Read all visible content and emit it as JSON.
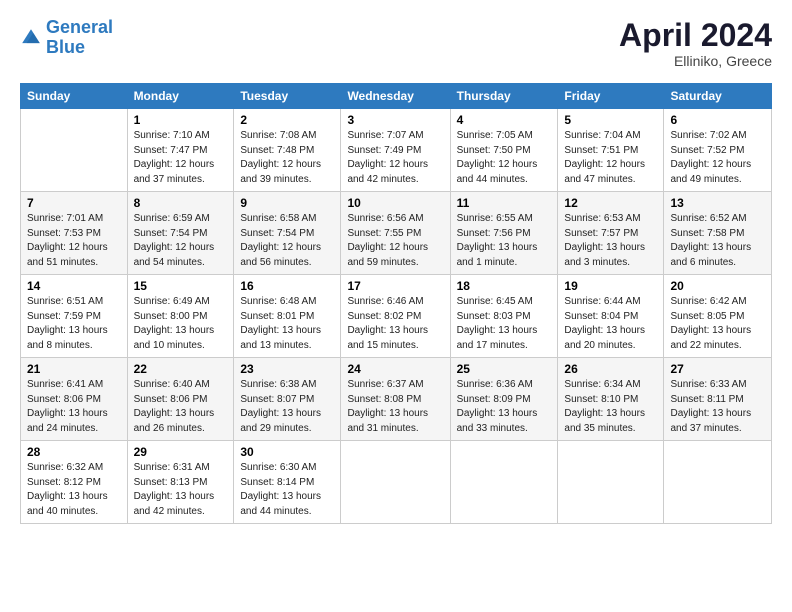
{
  "header": {
    "logo_line1": "General",
    "logo_line2": "Blue",
    "month_title": "April 2024",
    "location": "Elliniko, Greece"
  },
  "columns": [
    "Sunday",
    "Monday",
    "Tuesday",
    "Wednesday",
    "Thursday",
    "Friday",
    "Saturday"
  ],
  "weeks": [
    [
      {
        "day": "",
        "info": ""
      },
      {
        "day": "1",
        "info": "Sunrise: 7:10 AM\nSunset: 7:47 PM\nDaylight: 12 hours\nand 37 minutes."
      },
      {
        "day": "2",
        "info": "Sunrise: 7:08 AM\nSunset: 7:48 PM\nDaylight: 12 hours\nand 39 minutes."
      },
      {
        "day": "3",
        "info": "Sunrise: 7:07 AM\nSunset: 7:49 PM\nDaylight: 12 hours\nand 42 minutes."
      },
      {
        "day": "4",
        "info": "Sunrise: 7:05 AM\nSunset: 7:50 PM\nDaylight: 12 hours\nand 44 minutes."
      },
      {
        "day": "5",
        "info": "Sunrise: 7:04 AM\nSunset: 7:51 PM\nDaylight: 12 hours\nand 47 minutes."
      },
      {
        "day": "6",
        "info": "Sunrise: 7:02 AM\nSunset: 7:52 PM\nDaylight: 12 hours\nand 49 minutes."
      }
    ],
    [
      {
        "day": "7",
        "info": "Sunrise: 7:01 AM\nSunset: 7:53 PM\nDaylight: 12 hours\nand 51 minutes."
      },
      {
        "day": "8",
        "info": "Sunrise: 6:59 AM\nSunset: 7:54 PM\nDaylight: 12 hours\nand 54 minutes."
      },
      {
        "day": "9",
        "info": "Sunrise: 6:58 AM\nSunset: 7:54 PM\nDaylight: 12 hours\nand 56 minutes."
      },
      {
        "day": "10",
        "info": "Sunrise: 6:56 AM\nSunset: 7:55 PM\nDaylight: 12 hours\nand 59 minutes."
      },
      {
        "day": "11",
        "info": "Sunrise: 6:55 AM\nSunset: 7:56 PM\nDaylight: 13 hours\nand 1 minute."
      },
      {
        "day": "12",
        "info": "Sunrise: 6:53 AM\nSunset: 7:57 PM\nDaylight: 13 hours\nand 3 minutes."
      },
      {
        "day": "13",
        "info": "Sunrise: 6:52 AM\nSunset: 7:58 PM\nDaylight: 13 hours\nand 6 minutes."
      }
    ],
    [
      {
        "day": "14",
        "info": "Sunrise: 6:51 AM\nSunset: 7:59 PM\nDaylight: 13 hours\nand 8 minutes."
      },
      {
        "day": "15",
        "info": "Sunrise: 6:49 AM\nSunset: 8:00 PM\nDaylight: 13 hours\nand 10 minutes."
      },
      {
        "day": "16",
        "info": "Sunrise: 6:48 AM\nSunset: 8:01 PM\nDaylight: 13 hours\nand 13 minutes."
      },
      {
        "day": "17",
        "info": "Sunrise: 6:46 AM\nSunset: 8:02 PM\nDaylight: 13 hours\nand 15 minutes."
      },
      {
        "day": "18",
        "info": "Sunrise: 6:45 AM\nSunset: 8:03 PM\nDaylight: 13 hours\nand 17 minutes."
      },
      {
        "day": "19",
        "info": "Sunrise: 6:44 AM\nSunset: 8:04 PM\nDaylight: 13 hours\nand 20 minutes."
      },
      {
        "day": "20",
        "info": "Sunrise: 6:42 AM\nSunset: 8:05 PM\nDaylight: 13 hours\nand 22 minutes."
      }
    ],
    [
      {
        "day": "21",
        "info": "Sunrise: 6:41 AM\nSunset: 8:06 PM\nDaylight: 13 hours\nand 24 minutes."
      },
      {
        "day": "22",
        "info": "Sunrise: 6:40 AM\nSunset: 8:06 PM\nDaylight: 13 hours\nand 26 minutes."
      },
      {
        "day": "23",
        "info": "Sunrise: 6:38 AM\nSunset: 8:07 PM\nDaylight: 13 hours\nand 29 minutes."
      },
      {
        "day": "24",
        "info": "Sunrise: 6:37 AM\nSunset: 8:08 PM\nDaylight: 13 hours\nand 31 minutes."
      },
      {
        "day": "25",
        "info": "Sunrise: 6:36 AM\nSunset: 8:09 PM\nDaylight: 13 hours\nand 33 minutes."
      },
      {
        "day": "26",
        "info": "Sunrise: 6:34 AM\nSunset: 8:10 PM\nDaylight: 13 hours\nand 35 minutes."
      },
      {
        "day": "27",
        "info": "Sunrise: 6:33 AM\nSunset: 8:11 PM\nDaylight: 13 hours\nand 37 minutes."
      }
    ],
    [
      {
        "day": "28",
        "info": "Sunrise: 6:32 AM\nSunset: 8:12 PM\nDaylight: 13 hours\nand 40 minutes."
      },
      {
        "day": "29",
        "info": "Sunrise: 6:31 AM\nSunset: 8:13 PM\nDaylight: 13 hours\nand 42 minutes."
      },
      {
        "day": "30",
        "info": "Sunrise: 6:30 AM\nSunset: 8:14 PM\nDaylight: 13 hours\nand 44 minutes."
      },
      {
        "day": "",
        "info": ""
      },
      {
        "day": "",
        "info": ""
      },
      {
        "day": "",
        "info": ""
      },
      {
        "day": "",
        "info": ""
      }
    ]
  ]
}
